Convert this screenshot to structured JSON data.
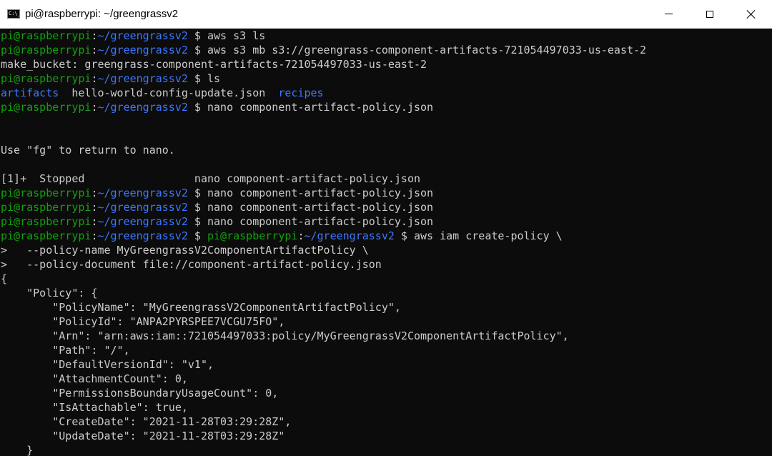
{
  "window": {
    "title": "pi@raspberrypi: ~/greengrassv2",
    "icon_text": "C:\\_"
  },
  "colors": {
    "background": "#0c0c0c",
    "text": "#cccccc",
    "prompt_user": "#13a10e",
    "prompt_path": "#3b78ff",
    "directory": "#3b78ff"
  },
  "terminal": {
    "lines": [
      [
        {
          "t": "pi@raspberrypi",
          "c": "g"
        },
        {
          "t": ":",
          "c": "w"
        },
        {
          "t": "~/greengrassv2",
          "c": "b"
        },
        {
          "t": " $ aws s3 ls",
          "c": "w"
        }
      ],
      [
        {
          "t": "pi@raspberrypi",
          "c": "g"
        },
        {
          "t": ":",
          "c": "w"
        },
        {
          "t": "~/greengrassv2",
          "c": "b"
        },
        {
          "t": " $ aws s3 mb s3://greengrass-component-artifacts-721054497033-us-east-2",
          "c": "w"
        }
      ],
      [
        {
          "t": "make_bucket: greengrass-component-artifacts-721054497033-us-east-2",
          "c": "w"
        }
      ],
      [
        {
          "t": "pi@raspberrypi",
          "c": "g"
        },
        {
          "t": ":",
          "c": "w"
        },
        {
          "t": "~/greengrassv2",
          "c": "b"
        },
        {
          "t": " $ ls",
          "c": "w"
        }
      ],
      [
        {
          "t": "artifacts",
          "c": "b"
        },
        {
          "t": "  hello-world-config-update.json  ",
          "c": "w"
        },
        {
          "t": "recipes",
          "c": "b"
        }
      ],
      [
        {
          "t": "pi@raspberrypi",
          "c": "g"
        },
        {
          "t": ":",
          "c": "w"
        },
        {
          "t": "~/greengrassv2",
          "c": "b"
        },
        {
          "t": " $ nano component-artifact-policy.json",
          "c": "w"
        }
      ],
      [],
      [],
      [
        {
          "t": "Use \"fg\" to return to nano.",
          "c": "w"
        }
      ],
      [],
      [
        {
          "t": "[1]+  Stopped                 nano component-artifact-policy.json",
          "c": "w"
        }
      ],
      [
        {
          "t": "pi@raspberrypi",
          "c": "g"
        },
        {
          "t": ":",
          "c": "w"
        },
        {
          "t": "~/greengrassv2",
          "c": "b"
        },
        {
          "t": " $ nano component-artifact-policy.json",
          "c": "w"
        }
      ],
      [
        {
          "t": "pi@raspberrypi",
          "c": "g"
        },
        {
          "t": ":",
          "c": "w"
        },
        {
          "t": "~/greengrassv2",
          "c": "b"
        },
        {
          "t": " $ nano component-artifact-policy.json",
          "c": "w"
        }
      ],
      [
        {
          "t": "pi@raspberrypi",
          "c": "g"
        },
        {
          "t": ":",
          "c": "w"
        },
        {
          "t": "~/greengrassv2",
          "c": "b"
        },
        {
          "t": " $ nano component-artifact-policy.json",
          "c": "w"
        }
      ],
      [
        {
          "t": "pi@raspberrypi",
          "c": "g"
        },
        {
          "t": ":",
          "c": "w"
        },
        {
          "t": "~/greengrassv2",
          "c": "b"
        },
        {
          "t": " $ ",
          "c": "w"
        },
        {
          "t": "pi@raspberrypi",
          "c": "g"
        },
        {
          "t": ":",
          "c": "w"
        },
        {
          "t": "~/greengrassv2",
          "c": "b"
        },
        {
          "t": " $ aws iam create-policy \\",
          "c": "w"
        }
      ],
      [
        {
          "t": ">   --policy-name MyGreengrassV2ComponentArtifactPolicy \\",
          "c": "w"
        }
      ],
      [
        {
          "t": ">   --policy-document file://component-artifact-policy.json",
          "c": "w"
        }
      ],
      [
        {
          "t": "{",
          "c": "w"
        }
      ],
      [
        {
          "t": "    \"Policy\": {",
          "c": "w"
        }
      ],
      [
        {
          "t": "        \"PolicyName\": \"MyGreengrassV2ComponentArtifactPolicy\",",
          "c": "w"
        }
      ],
      [
        {
          "t": "        \"PolicyId\": \"ANPA2PYRSPEE7VCGU75FO\",",
          "c": "w"
        }
      ],
      [
        {
          "t": "        \"Arn\": \"arn:aws:iam::721054497033:policy/MyGreengrassV2ComponentArtifactPolicy\",",
          "c": "w"
        }
      ],
      [
        {
          "t": "        \"Path\": \"/\",",
          "c": "w"
        }
      ],
      [
        {
          "t": "        \"DefaultVersionId\": \"v1\",",
          "c": "w"
        }
      ],
      [
        {
          "t": "        \"AttachmentCount\": 0,",
          "c": "w"
        }
      ],
      [
        {
          "t": "        \"PermissionsBoundaryUsageCount\": 0,",
          "c": "w"
        }
      ],
      [
        {
          "t": "        \"IsAttachable\": true,",
          "c": "w"
        }
      ],
      [
        {
          "t": "        \"CreateDate\": \"2021-11-28T03:29:28Z\",",
          "c": "w"
        }
      ],
      [
        {
          "t": "        \"UpdateDate\": \"2021-11-28T03:29:28Z\"",
          "c": "w"
        }
      ],
      [
        {
          "t": "    }",
          "c": "w"
        }
      ]
    ]
  }
}
